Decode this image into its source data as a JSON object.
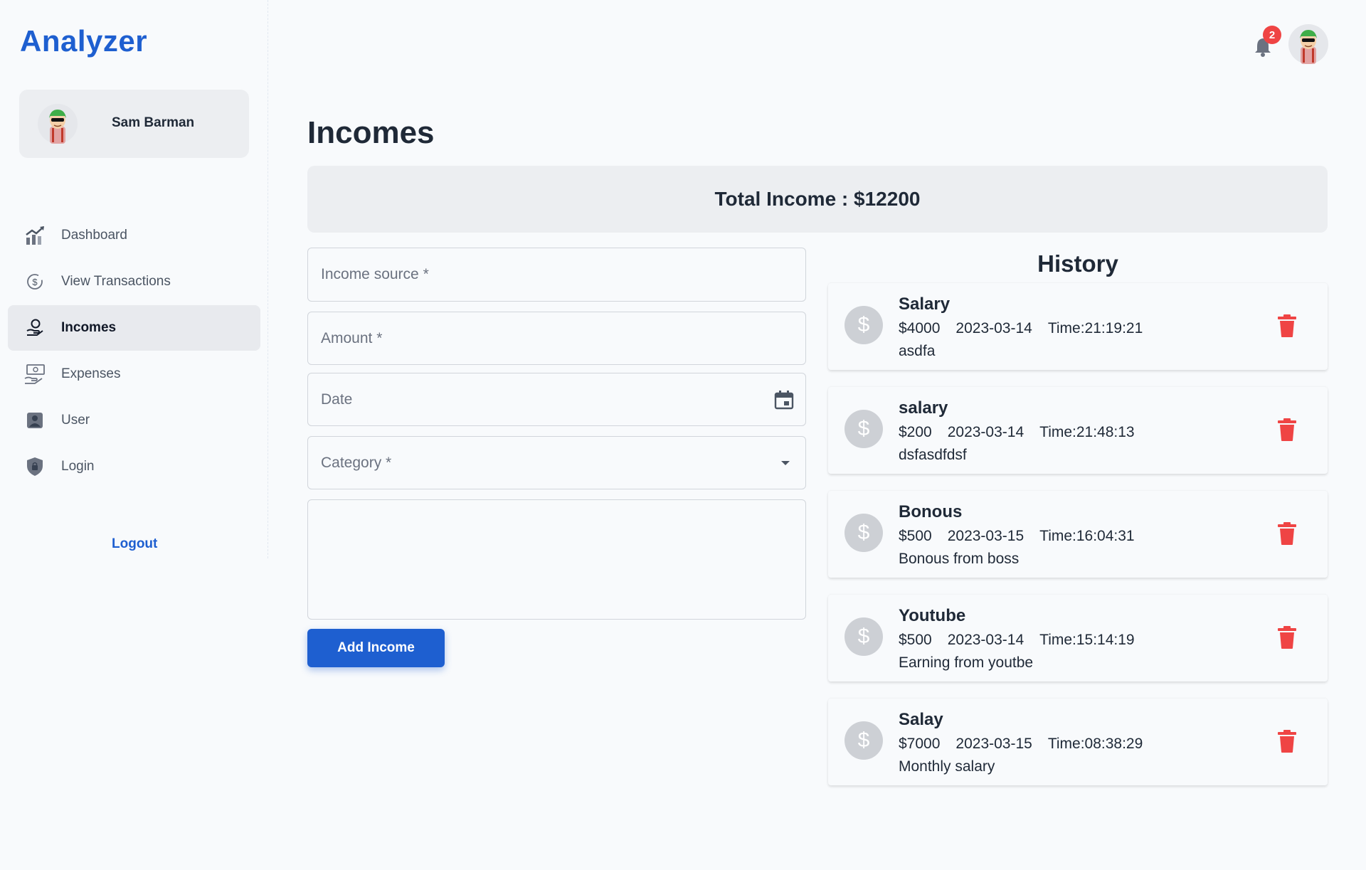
{
  "app": {
    "brand": "Analyzer"
  },
  "user": {
    "name": "Sam Barman",
    "notifications": "2"
  },
  "sidebar": {
    "items": [
      {
        "label": "Dashboard",
        "icon": "chart-trend-icon",
        "active": false
      },
      {
        "label": "View Transactions",
        "icon": "dollar-cycle-icon",
        "active": false
      },
      {
        "label": "Incomes",
        "icon": "income-hand-icon",
        "active": true
      },
      {
        "label": "Expenses",
        "icon": "expense-cash-icon",
        "active": false
      },
      {
        "label": "User",
        "icon": "user-icon",
        "active": false
      },
      {
        "label": "Login",
        "icon": "shield-lock-icon",
        "active": false
      }
    ],
    "logout": "Logout"
  },
  "main": {
    "title": "Incomes",
    "total_label": "Total Income : $12200",
    "form": {
      "source_placeholder": "Income source *",
      "amount_placeholder": "Amount *",
      "date_placeholder": "Date",
      "category_placeholder": "Category *",
      "description_value": "",
      "submit_label": "Add Income"
    },
    "history": {
      "title": "History",
      "items": [
        {
          "title": "Salary",
          "amount": "$4000",
          "date": "2023-03-14",
          "time": "Time:21:19:21",
          "desc": "asdfa"
        },
        {
          "title": "salary",
          "amount": "$200",
          "date": "2023-03-14",
          "time": "Time:21:48:13",
          "desc": "dsfasdfdsf"
        },
        {
          "title": "Bonous",
          "amount": "$500",
          "date": "2023-03-15",
          "time": "Time:16:04:31",
          "desc": "Bonous from boss"
        },
        {
          "title": "Youtube",
          "amount": "$500",
          "date": "2023-03-14",
          "time": "Time:15:14:19",
          "desc": "Earning from youtbe"
        },
        {
          "title": "Salay",
          "amount": "$7000",
          "date": "2023-03-15",
          "time": "Time:08:38:29",
          "desc": "Monthly salary"
        }
      ]
    }
  },
  "colors": {
    "accent": "#1e5fd0",
    "danger": "#ef4444",
    "card": "#eceef1"
  }
}
